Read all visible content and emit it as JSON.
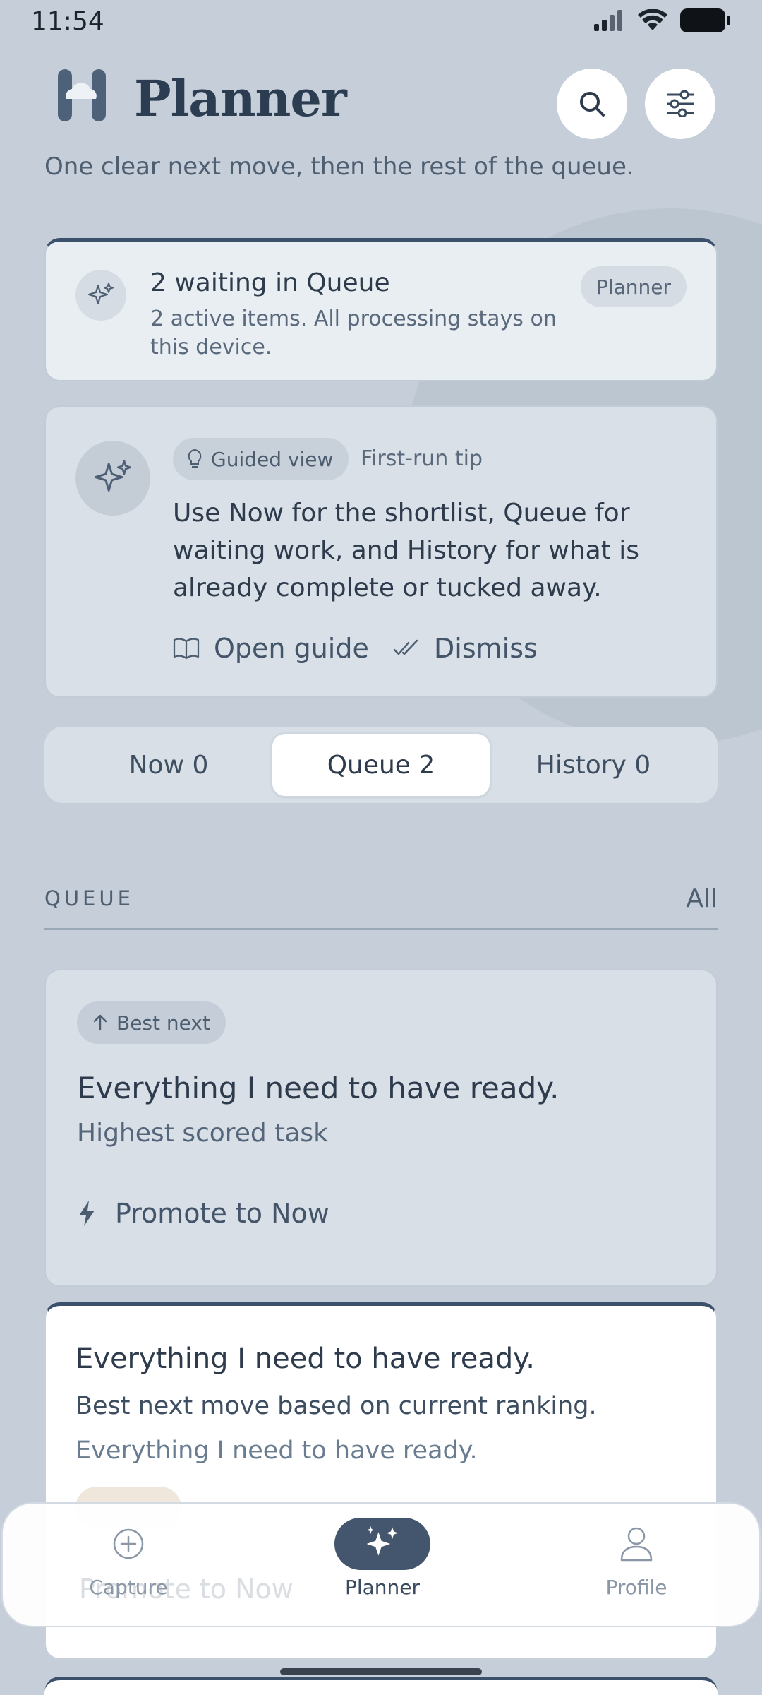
{
  "status_bar": {
    "time": "11:54"
  },
  "header": {
    "app_title": "Planner",
    "subtitle": "One clear next move, then the rest of the queue.",
    "search_icon": "search-icon",
    "filter_icon": "sliders-icon"
  },
  "status_card": {
    "title": "2 waiting in Queue",
    "description": "2 active items. All processing stays on this device.",
    "badge": "Planner"
  },
  "tip_card": {
    "pill": "Guided view",
    "label": "First-run tip",
    "text": "Use Now for the shortlist, Queue for waiting work, and History for what is already complete or tucked away.",
    "open_guide": "Open guide",
    "dismiss": "Dismiss"
  },
  "tabs": [
    {
      "label": "Now 0",
      "active": false
    },
    {
      "label": "Queue 2",
      "active": true
    },
    {
      "label": "History 0",
      "active": false
    }
  ],
  "section": {
    "label": "QUEUE",
    "filter": "All"
  },
  "best_card": {
    "pill": "Best next",
    "title": "Everything I need to have ready.",
    "subtitle": "Highest scored task",
    "action": "Promote to Now"
  },
  "task_card": {
    "title": "Everything I need to have ready.",
    "description": "Best next move based on current ranking.",
    "note": "Everything I need to have ready.",
    "action_ghost": "Promote to Now"
  },
  "bottom_nav": [
    {
      "label": "Capture",
      "icon": "plus-circle-icon",
      "active": false
    },
    {
      "label": "Planner",
      "icon": "sparkles-icon",
      "active": true
    },
    {
      "label": "Profile",
      "icon": "person-icon",
      "active": false
    }
  ],
  "colors": {
    "accent": "#3b506a",
    "background": "#c5ced9",
    "nav_active": "#43566d"
  }
}
